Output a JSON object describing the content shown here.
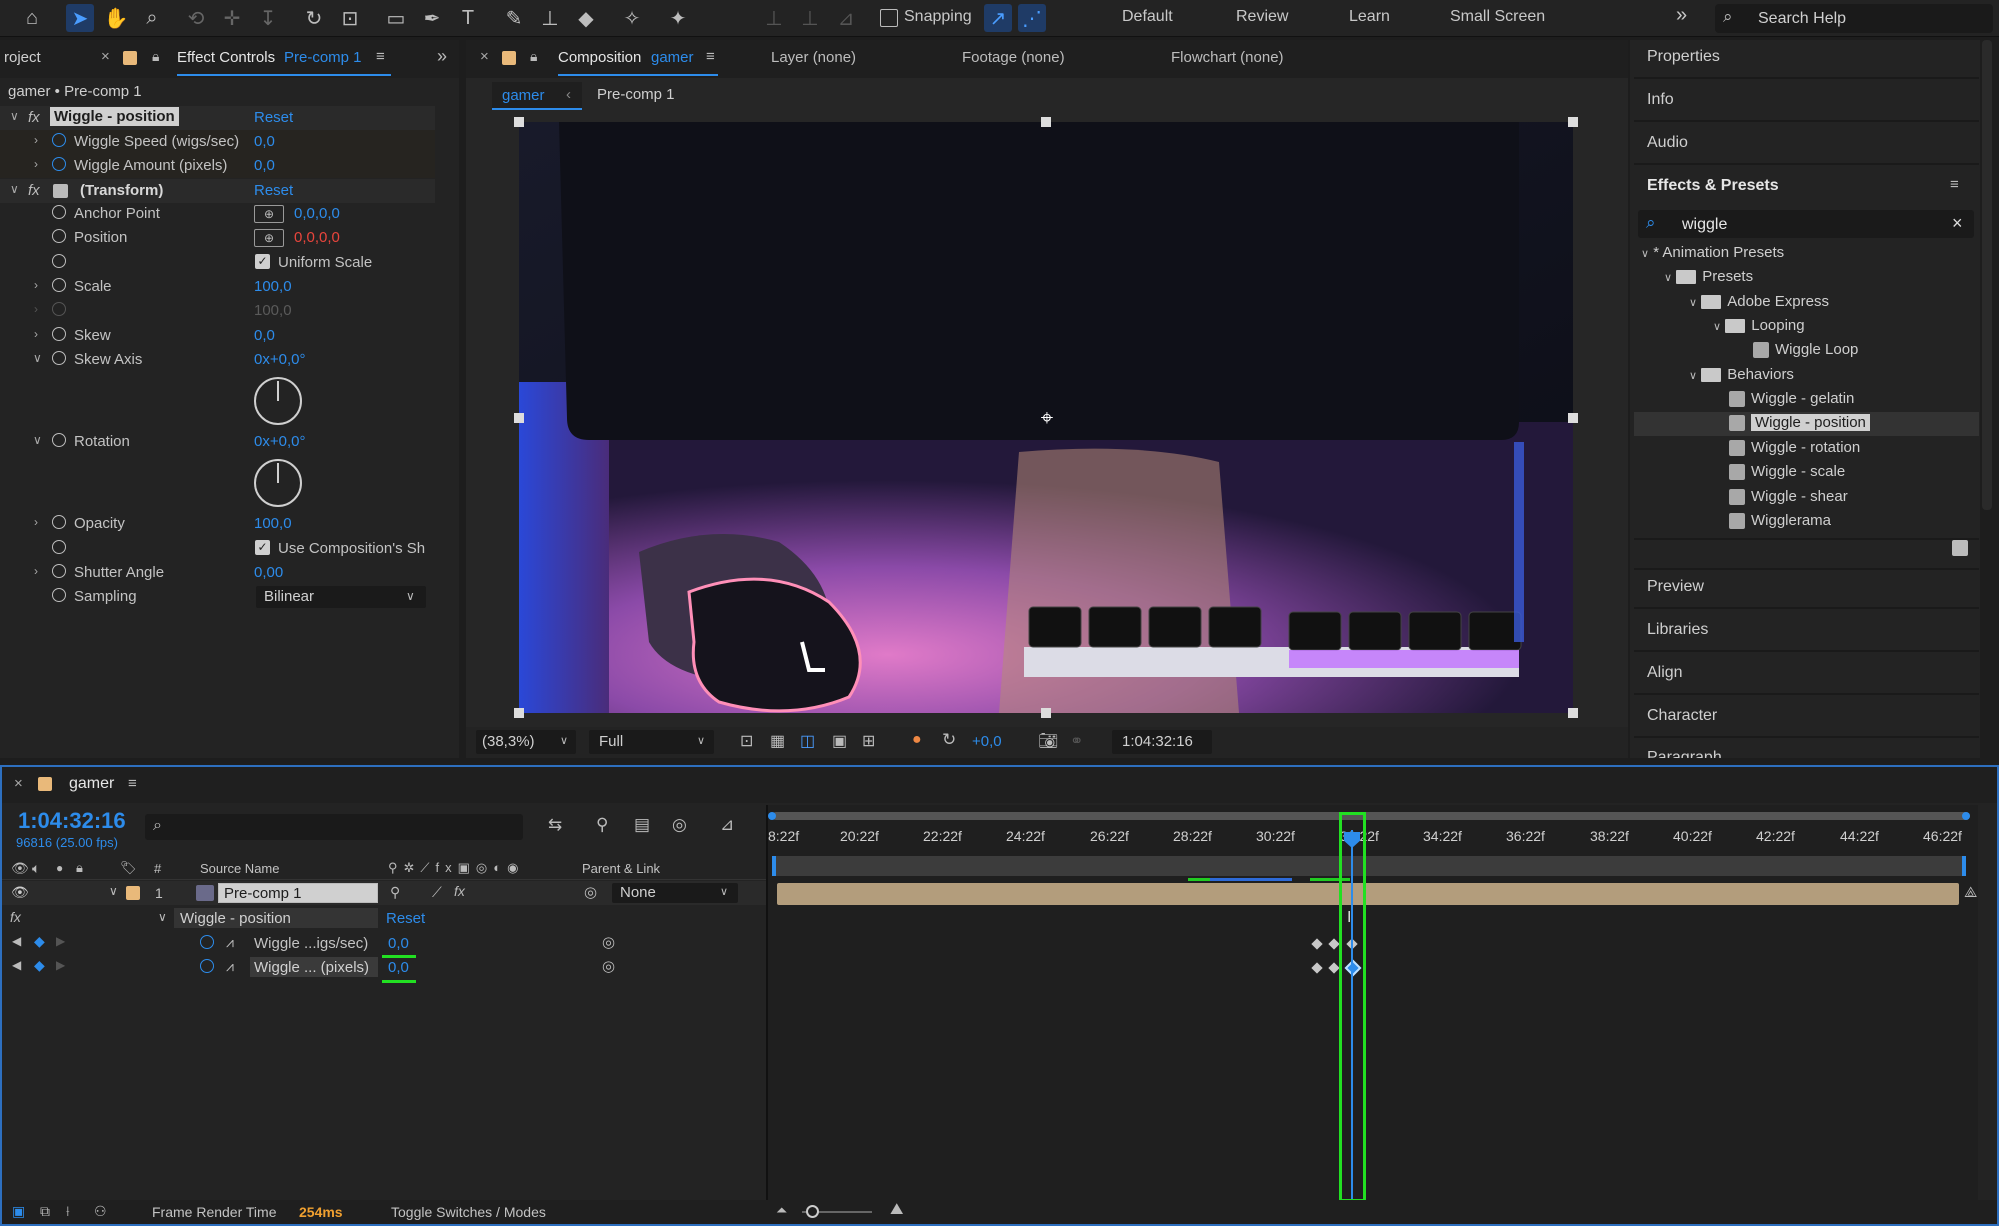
{
  "toolbar": {
    "snapping_label": "Snapping",
    "workspaces": [
      "Default",
      "Review",
      "Learn",
      "Small Screen"
    ],
    "more": "»",
    "search_placeholder": "Search Help"
  },
  "effect_controls": {
    "project_tab": "roject",
    "tab_label": "Effect Controls",
    "tab_comp": "Pre-comp 1",
    "breadcrumb": "gamer • Pre-comp 1",
    "wiggle_name": "Wiggle - position",
    "reset": "Reset",
    "wiggle_speed_label": "Wiggle Speed (wigs/sec)",
    "wiggle_speed_value": "0,0",
    "wiggle_amount_label": "Wiggle Amount (pixels)",
    "wiggle_amount_value": "0,0",
    "transform_label": "(Transform)",
    "anchor_label": "Anchor Point",
    "anchor_value": "0,0,0,0",
    "position_label": "Position",
    "position_value": "0,0,0,0",
    "uniform_scale": "Uniform Scale",
    "scale_label": "Scale",
    "scale_value": "100,0",
    "scale2_value": "100,0",
    "skew_label": "Skew",
    "skew_value": "0,0",
    "skew_axis_label": "Skew Axis",
    "skew_axis_value": "0x+0,0°",
    "rotation_label": "Rotation",
    "rotation_value": "0x+0,0°",
    "opacity_label": "Opacity",
    "opacity_value": "100,0",
    "use_comp": "Use Composition's Sh",
    "shutter_label": "Shutter Angle",
    "shutter_value": "0,00",
    "sampling_label": "Sampling",
    "sampling_value": "Bilinear"
  },
  "composition": {
    "tab_label": "Composition",
    "tab_name": "gamer",
    "layer_tab": "Layer (none)",
    "footage_tab": "Footage (none)",
    "flowchart_tab": "Flowchart (none)",
    "sub_tab_active": "gamer",
    "sub_tab_2": "Pre-comp 1",
    "zoom": "(38,3%)",
    "resolution": "Full",
    "exposure": "+0,0",
    "timecode": "1:04:32:16"
  },
  "right_panel": {
    "properties": "Properties",
    "info": "Info",
    "audio": "Audio",
    "effects_presets": "Effects & Presets",
    "search_value": "wiggle",
    "tree": {
      "animation_presets": "* Animation Presets",
      "presets": "Presets",
      "adobe_express": "Adobe Express",
      "looping": "Looping",
      "wiggle_loop": "Wiggle Loop",
      "behaviors": "Behaviors",
      "items": [
        "Wiggle - gelatin",
        "Wiggle - position",
        "Wiggle - rotation",
        "Wiggle - scale",
        "Wiggle - shear",
        "Wigglerama"
      ]
    },
    "preview": "Preview",
    "libraries": "Libraries",
    "align": "Align",
    "character": "Character",
    "paragraph": "Paragraph"
  },
  "timeline": {
    "tab_name": "gamer",
    "timecode": "1:04:32:16",
    "frame_info": "96816 (25.00 fps)",
    "col_hash": "#",
    "col_source": "Source Name",
    "col_parent": "Parent & Link",
    "layer_num": "1",
    "layer_name": "Pre-comp 1",
    "parent_value": "None",
    "fx_name": "Wiggle - position",
    "reset": "Reset",
    "prop1_name": "Wiggle ...igs/sec)",
    "prop1_value": "0,0",
    "prop2_name": "Wiggle ... (pixels)",
    "prop2_value": "0,0",
    "ruler": [
      "8:22f",
      "20:22f",
      "22:22f",
      "24:22f",
      "26:22f",
      "28:22f",
      "30:22f",
      "32:22f",
      "34:22f",
      "36:22f",
      "38:22f",
      "40:22f",
      "42:22f",
      "44:22f",
      "46:22f"
    ],
    "frame_render_label": "Frame Render Time",
    "frame_render_value": "254ms",
    "toggle_label": "Toggle Switches / Modes"
  },
  "colors": {
    "accent": "#2d8ceb",
    "highlight": "#22e022",
    "red": "#e8453c",
    "orange": "#f0a030"
  }
}
